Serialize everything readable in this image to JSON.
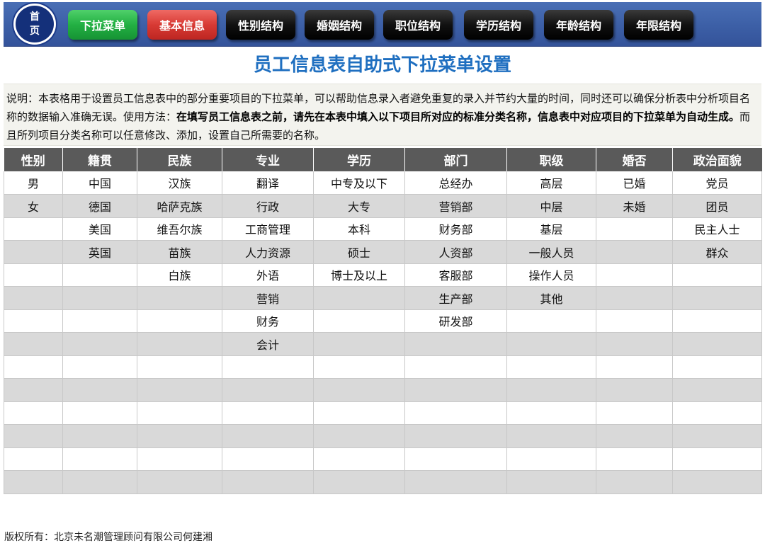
{
  "nav": {
    "home_line1": "首",
    "home_line2": "页",
    "buttons": [
      {
        "label": "下拉菜单",
        "color": "#23b043"
      },
      {
        "label": "基本信息",
        "color": "#d83a34"
      },
      {
        "label": "性别结构",
        "color": "#111111"
      },
      {
        "label": "婚姻结构",
        "color": "#111111"
      },
      {
        "label": "职位结构",
        "color": "#111111"
      },
      {
        "label": "学历结构",
        "color": "#111111"
      },
      {
        "label": "年龄结构",
        "color": "#111111"
      },
      {
        "label": "年限结构",
        "color": "#111111"
      }
    ]
  },
  "page_title": "员工信息表自助式下拉菜单设置",
  "description": {
    "part1": "说明：本表格用于设置员工信息表中的部分重要项目的下拉菜单，可以帮助信息录入者避免重复的录入并节约大量的时间，同时还可以确保分析表中分析项目名称的数据输入准确无误。使用方法：",
    "bold": "在填写员工信息表之前，请先在本表中填入以下项目所对应的标准分类名称，信息表中对应项目的下拉菜单为自动生成。",
    "part2": "而且所列项目分类名称可以任意修改、添加，设置自己所需要的名称。"
  },
  "table": {
    "headers": [
      "性别",
      "籍贯",
      "民族",
      "专业",
      "学历",
      "部门",
      "职级",
      "婚否",
      "政治面貌"
    ],
    "rows": [
      [
        "男",
        "中国",
        "汉族",
        "翻译",
        "中专及以下",
        "总经办",
        "高层",
        "已婚",
        "党员"
      ],
      [
        "女",
        "德国",
        "哈萨克族",
        "行政",
        "大专",
        "营销部",
        "中层",
        "未婚",
        "团员"
      ],
      [
        "",
        "美国",
        "维吾尔族",
        "工商管理",
        "本科",
        "财务部",
        "基层",
        "",
        "民主人士"
      ],
      [
        "",
        "英国",
        "苗族",
        "人力资源",
        "硕士",
        "人资部",
        "一般人员",
        "",
        "群众"
      ],
      [
        "",
        "",
        "白族",
        "外语",
        "博士及以上",
        "客服部",
        "操作人员",
        "",
        ""
      ],
      [
        "",
        "",
        "",
        "营销",
        "",
        "生产部",
        "其他",
        "",
        ""
      ],
      [
        "",
        "",
        "",
        "财务",
        "",
        "研发部",
        "",
        "",
        ""
      ],
      [
        "",
        "",
        "",
        "会计",
        "",
        "",
        "",
        "",
        ""
      ],
      [
        "",
        "",
        "",
        "",
        "",
        "",
        "",
        "",
        ""
      ],
      [
        "",
        "",
        "",
        "",
        "",
        "",
        "",
        "",
        ""
      ],
      [
        "",
        "",
        "",
        "",
        "",
        "",
        "",
        "",
        ""
      ],
      [
        "",
        "",
        "",
        "",
        "",
        "",
        "",
        "",
        ""
      ],
      [
        "",
        "",
        "",
        "",
        "",
        "",
        "",
        "",
        ""
      ],
      [
        "",
        "",
        "",
        "",
        "",
        "",
        "",
        "",
        ""
      ]
    ]
  },
  "footer": "版权所有：北京未名潮管理顾问有限公司何建湘"
}
